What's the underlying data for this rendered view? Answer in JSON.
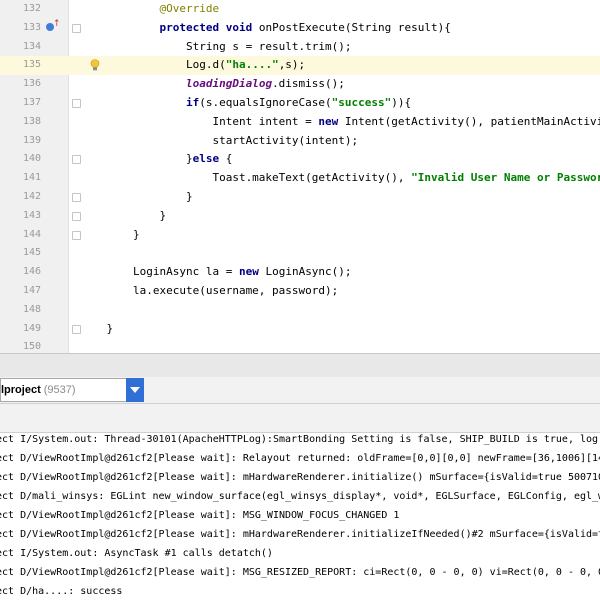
{
  "editor": {
    "lines": [
      {
        "num": "132",
        "segments": [
          {
            "t": "            ",
            "c": ""
          },
          {
            "t": "@Override",
            "c": "anno"
          }
        ]
      },
      {
        "num": "133",
        "segments": [
          {
            "t": "            ",
            "c": ""
          },
          {
            "t": "protected void ",
            "c": "kw"
          },
          {
            "t": "onPostExecute(String result){",
            "c": ""
          }
        ]
      },
      {
        "num": "134",
        "segments": [
          {
            "t": "                String s = result.trim();",
            "c": ""
          }
        ]
      },
      {
        "num": "135",
        "segments": [
          {
            "t": "                Log.d(",
            "c": ""
          },
          {
            "t": "\"ha....\"",
            "c": "str"
          },
          {
            "t": ",s);",
            "c": ""
          }
        ]
      },
      {
        "num": "136",
        "segments": [
          {
            "t": "                ",
            "c": ""
          },
          {
            "t": "loadingDialog",
            "c": "field"
          },
          {
            "t": ".dismiss();",
            "c": ""
          }
        ]
      },
      {
        "num": "137",
        "segments": [
          {
            "t": "                ",
            "c": ""
          },
          {
            "t": "if",
            "c": "kw"
          },
          {
            "t": "(s.equalsIgnoreCase(",
            "c": ""
          },
          {
            "t": "\"success\"",
            "c": "str"
          },
          {
            "t": ")){",
            "c": ""
          }
        ]
      },
      {
        "num": "138",
        "segments": [
          {
            "t": "                    Intent intent = ",
            "c": ""
          },
          {
            "t": "new ",
            "c": "kw"
          },
          {
            "t": "Intent(getActivity(), patientMainActivity.",
            "c": ""
          },
          {
            "t": "class",
            "c": "kw"
          }
        ]
      },
      {
        "num": "139",
        "segments": [
          {
            "t": "                    startActivity(intent);",
            "c": ""
          }
        ]
      },
      {
        "num": "140",
        "segments": [
          {
            "t": "                }",
            "c": ""
          },
          {
            "t": "else ",
            "c": "kw"
          },
          {
            "t": "{",
            "c": ""
          }
        ]
      },
      {
        "num": "141",
        "segments": [
          {
            "t": "                    Toast.makeText(getActivity(), ",
            "c": ""
          },
          {
            "t": "\"Invalid User Name or Password\"",
            "c": "str"
          },
          {
            "t": ",",
            "c": ""
          }
        ]
      },
      {
        "num": "142",
        "segments": [
          {
            "t": "                }",
            "c": ""
          }
        ]
      },
      {
        "num": "143",
        "segments": [
          {
            "t": "            }",
            "c": ""
          }
        ]
      },
      {
        "num": "144",
        "segments": [
          {
            "t": "        }",
            "c": ""
          }
        ]
      },
      {
        "num": "145",
        "segments": []
      },
      {
        "num": "146",
        "segments": [
          {
            "t": "        LoginAsync la = ",
            "c": ""
          },
          {
            "t": "new ",
            "c": "kw"
          },
          {
            "t": "LoginAsync();",
            "c": ""
          }
        ]
      },
      {
        "num": "147",
        "segments": [
          {
            "t": "        la.execute(username, password);",
            "c": ""
          }
        ]
      },
      {
        "num": "148",
        "segments": []
      },
      {
        "num": "149",
        "segments": [
          {
            "t": "    }",
            "c": ""
          }
        ]
      },
      {
        "num": "150",
        "segments": []
      }
    ]
  },
  "logcat": {
    "process_selector": {
      "name": "lproject",
      "pid": "(9537)"
    },
    "lines": [
      "ect I/System.out: Thread-30101(ApacheHTTPLog):SmartBonding Setting is false, SHIP_BUILD is true, log",
      "ect D/ViewRootImpl@d261cf2[Please wait]: Relayout returned: oldFrame=[0,0][0,0] newFrame=[36,1006][140",
      "ect D/ViewRootImpl@d261cf2[Please wait]: mHardwareRenderer.initialize() mSurface={isValid=true 5007100",
      "ect D/mali_winsys: EGLint new_window_surface(egl_winsys_display*, void*, EGLSurface, EGLConfig, egl_wi",
      "ect D/ViewRootImpl@d261cf2[Please wait]: MSG_WINDOW_FOCUS_CHANGED 1",
      "ect D/ViewRootImpl@d261cf2[Please wait]: mHardwareRenderer.initializeIfNeeded()#2 mSurface={isValid=tr",
      "ect I/System.out: AsyncTask #1 calls detatch()",
      "ect D/ViewRootImpl@d261cf2[Please wait]: MSG_RESIZED_REPORT: ci=Rect(0, 0 - 0, 0) vi=Rect(0, 0 - 0, 0)",
      "ect D/ha....: success"
    ]
  },
  "colors": {
    "keyword": "#000080",
    "string": "#008000",
    "annotation": "#808000",
    "field": "#660e7a",
    "current_line": "#fdf9dd",
    "dropdown_accent": "#2f6fd6"
  }
}
